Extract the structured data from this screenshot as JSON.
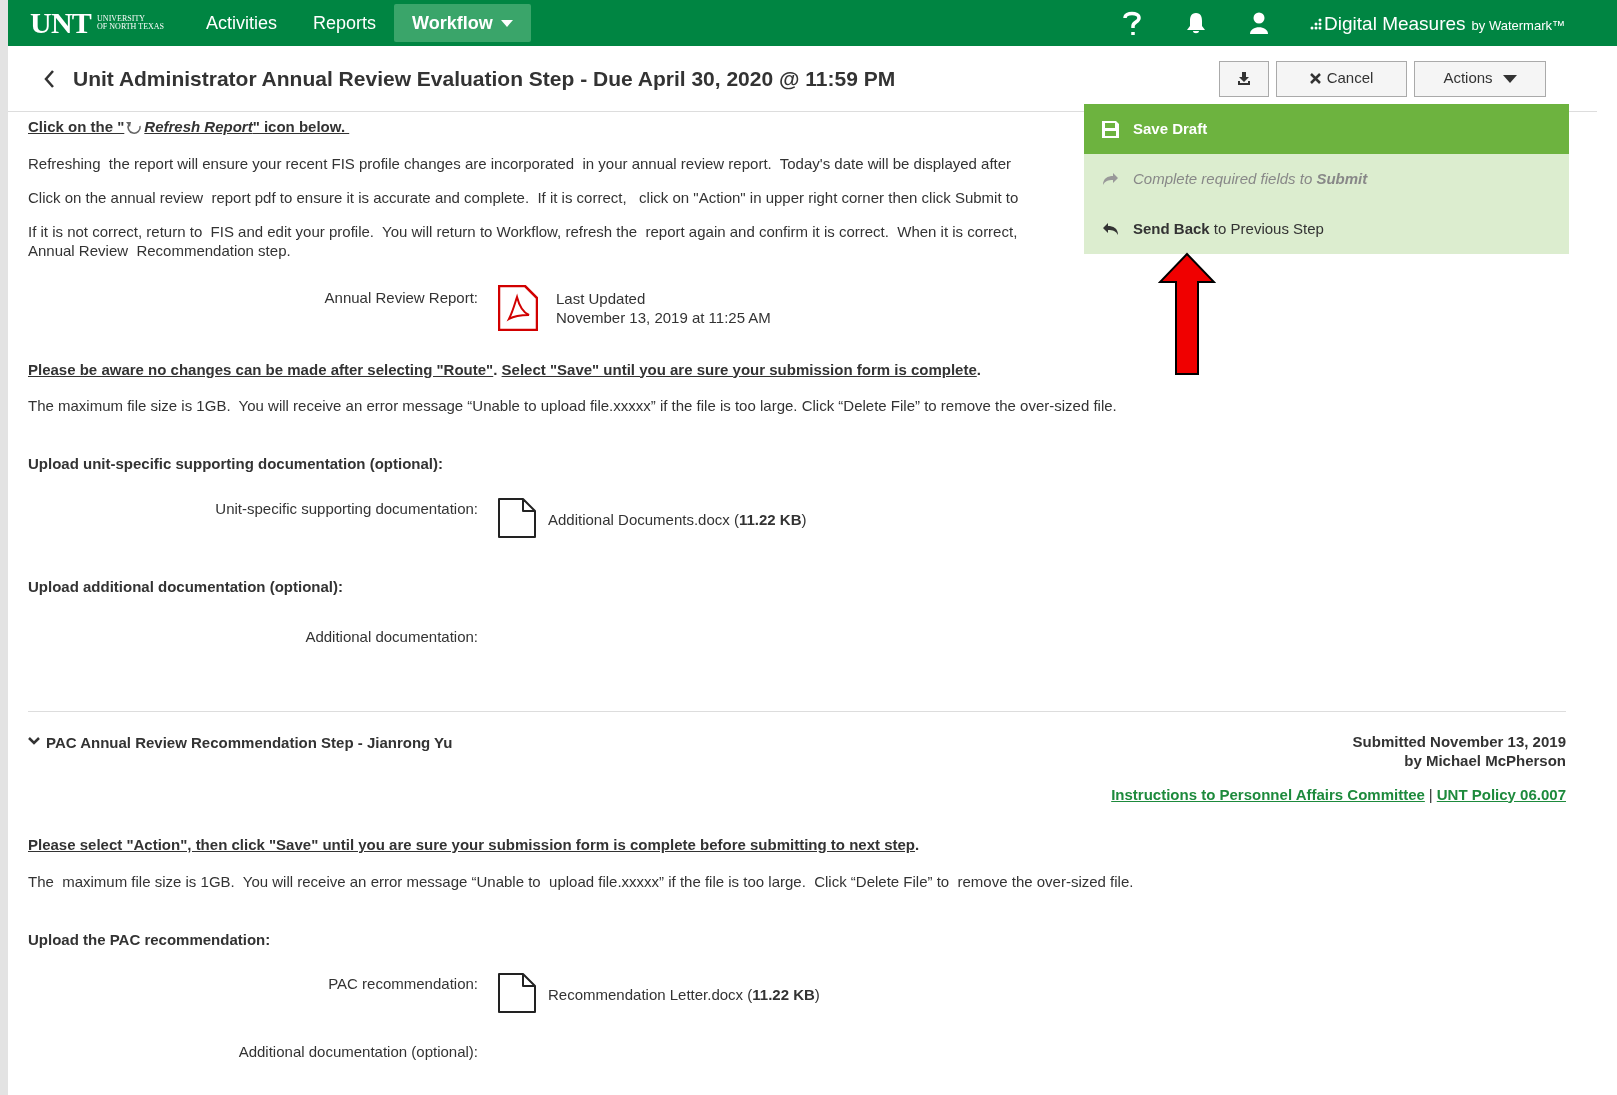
{
  "nav": {
    "logo": "UNT",
    "logo_lines": [
      "UNIVERSITY",
      "OF NORTH TEXAS"
    ],
    "items": [
      {
        "label": "Activities",
        "selected": false,
        "dropdown": false
      },
      {
        "label": "Reports",
        "selected": false,
        "dropdown": false
      },
      {
        "label": "Workflow",
        "selected": true,
        "dropdown": true
      }
    ],
    "brand": "Digital Measures",
    "brand_suffix": "by Watermark™"
  },
  "header": {
    "title": "Unit Administrator Annual Review Evaluation Step - Due April 30, 2020 @ 11:59 PM",
    "buttons": [
      {
        "kind": "download"
      },
      {
        "kind": "cancel",
        "label": "Cancel"
      },
      {
        "kind": "actions",
        "label": "Actions"
      }
    ]
  },
  "actions_menu": {
    "expanded": true,
    "items": [
      {
        "kind": "save",
        "label": "Save Draft",
        "selected": true,
        "disabled": false
      },
      {
        "kind": "submit",
        "label": "Complete required fields to **Submit**",
        "selected": false,
        "disabled": true
      },
      {
        "kind": "send_back",
        "label": "**Send Back** to Previous Step",
        "selected": false,
        "disabled": false
      }
    ]
  },
  "blocks": [
    {
      "kind": "refresh",
      "before": "Click on the \"",
      "after": "*Refresh Report*\" icon below. "
    },
    {
      "kind": "paragraph",
      "lines": [
        "Refreshing  the report will ensure your recent FIS profile changes are incorporated  in your annual review report.  Today's date will be displayed after"
      ]
    },
    {
      "kind": "paragraph",
      "lines": [
        "Click on the annual review  report pdf to ensure it is accurate and complete.  If it is correct,   click on \"Action\" in upper right corner then click Submit to"
      ]
    },
    {
      "kind": "paragraph",
      "lines": [
        "If it is not correct, return to  FIS and edit your profile.  You will return to Workflow, refresh the  report again and confirm it is correct.  When it is correct,",
        "Annual Review  Recommendation step."
      ]
    },
    {
      "kind": "report",
      "label": "Annual Review Report:",
      "updated_label": "Last Updated",
      "updated_date": "November 13, 2019 at 11:25 AM"
    },
    {
      "kind": "notice",
      "parts": [
        {
          "text": "Please be aware no changes can be made after selecting \"Route\"",
          "underlined": true
        },
        {
          "text": ". ",
          "underlined": false
        },
        {
          "text": "Select \"Save\" until you are sure your submission form is complete",
          "underlined": true
        },
        {
          "text": ".",
          "underlined": false
        }
      ]
    },
    {
      "kind": "paragraph",
      "lines": [
        "The maximum file size is 1GB.  You will receive an error message “Unable to upload file.xxxxx” if the file is too large. Click “Delete File” to remove the over-sized file."
      ]
    },
    {
      "kind": "heading",
      "text": "Upload unit-specific supporting documentation (optional):"
    },
    {
      "kind": "file",
      "label": "Unit-specific supporting documentation:",
      "file": "Additional Documents.docx (**11.22 KB**)"
    },
    {
      "kind": "heading",
      "text": "Upload additional documentation (optional):"
    },
    {
      "kind": "field",
      "label": "Additional documentation:"
    },
    {
      "kind": "divider"
    },
    {
      "kind": "step",
      "title": "PAC Annual Review Recommendation Step - Jianrong Yu",
      "expanded": true,
      "submitted": "Submitted November 13, 2019",
      "by": "by Michael McPherson"
    },
    {
      "kind": "links",
      "items": [
        "Instructions to Personnel Affairs Committee",
        "UNT Policy 06.007"
      ],
      "separator": "|"
    },
    {
      "kind": "notice",
      "parts": [
        {
          "text": "Please select \"Action\", then click \"Save\" until you are sure your submission form is complete before submitting to next step",
          "underlined": true
        },
        {
          "text": ".",
          "underlined": false
        }
      ]
    },
    {
      "kind": "paragraph",
      "lines": [
        "The  maximum file size is 1GB.  You will receive an error message “Unable to  upload file.xxxxx” if the file is too large.  Click “Delete File” to  remove the over-sized file."
      ]
    },
    {
      "kind": "heading",
      "text": "Upload the  PAC recommendation:"
    },
    {
      "kind": "file",
      "label": "PAC recommendation:",
      "file": "Recommendation Letter.docx (**11.22 KB**)"
    },
    {
      "kind": "field",
      "label": "Additional documentation (optional):"
    }
  ]
}
